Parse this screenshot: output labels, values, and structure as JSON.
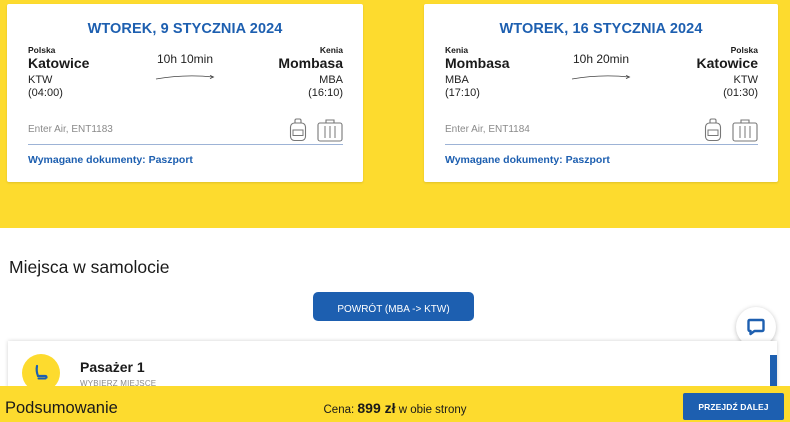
{
  "colors": {
    "accent_yellow": "#fddb2e",
    "brand_blue": "#1d5fb0",
    "muted_gray": "#8a8a8a"
  },
  "flights": [
    {
      "date": "WTOREK, 9 STYCZNIA 2024",
      "origin": {
        "country": "Polska",
        "city": "Katowice",
        "code": "KTW",
        "time": "(04:00)"
      },
      "destination": {
        "country": "Kenia",
        "city": "Mombasa",
        "code": "MBA",
        "time": "(16:10)"
      },
      "duration": "10h 10min",
      "airline": "Enter Air, ENT1183",
      "documents": "Wymagane dokumenty: Paszport",
      "icons": [
        "backpack-icon",
        "suitcase-icon"
      ]
    },
    {
      "date": "WTOREK, 16 STYCZNIA 2024",
      "origin": {
        "country": "Kenia",
        "city": "Mombasa",
        "code": "MBA",
        "time": "(17:10)"
      },
      "destination": {
        "country": "Polska",
        "city": "Katowice",
        "code": "KTW",
        "time": "(01:30)"
      },
      "duration": "10h 20min",
      "airline": "Enter Air, ENT1184",
      "documents": "Wymagane dokumenty: Paszport",
      "icons": [
        "backpack-icon",
        "suitcase-icon"
      ]
    }
  ],
  "seats": {
    "heading": "Miejsca w samolocie",
    "return_tab": "POWRÓT (MBA -> KTW)",
    "passenger": {
      "name": "Pasażer 1",
      "subtitle": "WYBIERZ MIEJSCE",
      "icon": "seat-icon"
    }
  },
  "chat": {
    "icon": "chat-icon"
  },
  "summary": {
    "label": "Podsumowanie",
    "price_prefix": "Cena:",
    "price_value": "899 zł",
    "price_suffix": "w obie strony",
    "next_button": "PRZEJDŹ DALEJ"
  }
}
